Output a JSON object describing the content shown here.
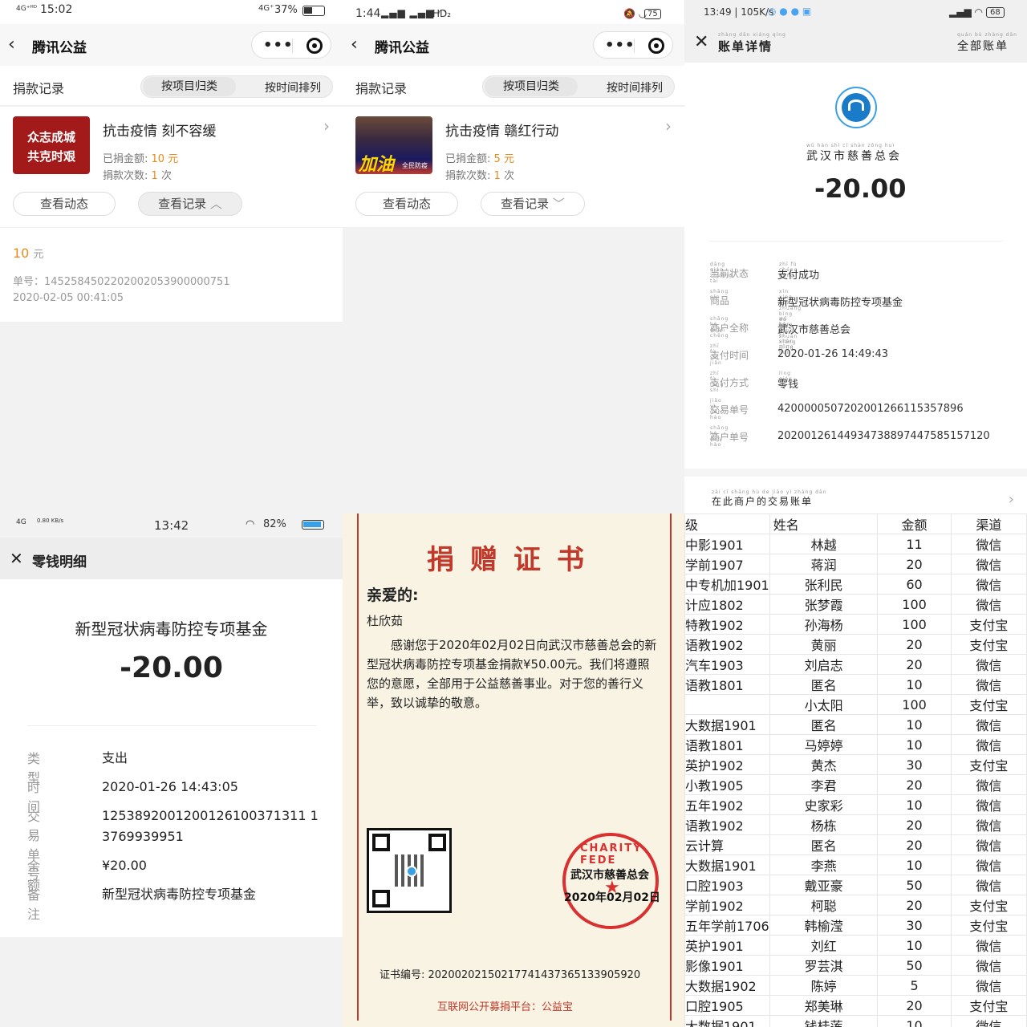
{
  "panel1": {
    "status": {
      "network": "4G⁺ᴴᴰ",
      "time": "15:02",
      "net2": "4G⁺",
      "battery": "37%"
    },
    "nav": {
      "title": "腾讯公益"
    },
    "records_label": "捐款记录",
    "seg": {
      "by_project": "按项目归类",
      "by_time": "按时间排列"
    },
    "thumb_text": [
      "众志成城",
      "共克时艰"
    ],
    "project": {
      "title": "抗击疫情 刻不容缓",
      "donated_label": "已捐金额:",
      "donated_value": "10",
      "donated_unit": "元",
      "count_label": "捐款次数:",
      "count_value": "1",
      "count_unit": "次"
    },
    "buttons": {
      "view_updates": "查看动态",
      "view_records": "查看记录"
    },
    "detail": {
      "amount": "10",
      "unit": "元",
      "order": "单号：14525845022020020539000007 51",
      "order_clean": "单号：1452584502202002053900000751",
      "date": "2020-02-05 00:41:05"
    }
  },
  "panel2": {
    "status": {
      "time": "1:44",
      "signal": "HD₂",
      "battery": "75"
    },
    "nav": {
      "title": "腾讯公益"
    },
    "records_label": "捐款记录",
    "seg": {
      "by_project": "按项目归类",
      "by_time": "按时间排列"
    },
    "thumb_text": "加油",
    "thumb_sub": "全民防疫",
    "project": {
      "title": "抗击疫情 赣红行动",
      "donated_label": "已捐金额:",
      "donated_value": "5",
      "donated_unit": "元",
      "count_label": "捐款次数:",
      "count_value": "1",
      "count_unit": "次"
    },
    "buttons": {
      "view_updates": "查看动态",
      "view_records": "查看记录"
    }
  },
  "panel3": {
    "status": {
      "time": "13:49 | 105K/s",
      "battery": "68"
    },
    "header": {
      "title": "账单详情",
      "title_pinyin": "zhàng dān xiáng qíng",
      "right": "全部账单",
      "right_pinyin": "quán bù zhàng dān"
    },
    "merchant_pinyin": "wǔ hàn shì cí shàn zǒng huì",
    "merchant": "武汉市慈善总会",
    "amount": "-20.00",
    "rows": [
      {
        "k": "当前状态",
        "kp": "dāng qián zhuàng tài",
        "v": "支付成功",
        "vp": "zhī fù chéng gōng"
      },
      {
        "k": "商品",
        "kp": "shāng pǐn",
        "v": "新型冠状病毒防控专项基金",
        "vp": "xīn xíng guàn zhuàng bìng dú fáng kòng zhuān xiàng jī jīn"
      },
      {
        "k": "商户全称",
        "kp": "shāng hù quán chēng",
        "v": "武汉市慈善总会",
        "vp": "wǔ hàn shì cí shàn zǒng huì"
      },
      {
        "k": "支付时间",
        "kp": "zhī fù shí jiān",
        "v": "2020-01-26 14:49:43",
        "vp": ""
      },
      {
        "k": "支付方式",
        "kp": "zhī fù fāng shì",
        "v": "零钱",
        "vp": "líng qián"
      },
      {
        "k": "交易单号",
        "kp": "jiāo yì dān hào",
        "v": "4200000507202001266115357896",
        "vp": ""
      },
      {
        "k": "商户单号",
        "kp": "shāng hù dān hào",
        "v": "20200126144934738897447585157120",
        "vp": ""
      }
    ],
    "footer": "在此商户的交易账单",
    "footer_pinyin": "zài cǐ shāng hù de jiāo yì zhàng dān"
  },
  "panel4": {
    "status": {
      "net": "4G",
      "speed": "0.80 KB/s",
      "time": "13:42",
      "battery": "82%"
    },
    "header": {
      "title": "零钱明细"
    },
    "fund": "新型冠状病毒防控专项基金",
    "amount": "-20.00",
    "rows": [
      {
        "k": "类型",
        "v": "支出"
      },
      {
        "k": "时间",
        "v": "2020-01-26 14:43:05"
      },
      {
        "k": "交易单号",
        "v": "1253892001200126100371311 13769939951"
      },
      {
        "k": "余额",
        "v": "¥20.00"
      },
      {
        "k": "备注",
        "v": "新型冠状病毒防控专项基金"
      }
    ]
  },
  "panel5": {
    "title": "捐赠证书",
    "salutation": "亲爱的:",
    "name": "杜欣茹",
    "body": "感谢您于2020年02月02日向武汉市慈善总会的新型冠状病毒防控专项基金捐款¥50.00元。我们将遵照您的意愿，全部用于公益慈善事业。对于您的善行义举，致以诚挚的敬意。",
    "seal_org": "武汉市慈善总会",
    "seal_date": "2020年02月02日",
    "seal_ring": "CHARITY FEDE",
    "cert_no": "证书编号: 20200202150217741437365133905920",
    "platform": "互联网公开募捐平台：公益宝"
  },
  "panel6": {
    "headers": [
      "级",
      "姓名",
      "金额",
      "渠道"
    ],
    "rows": [
      [
        "中影1901",
        "林越",
        "11",
        "微信"
      ],
      [
        "学前1907",
        "蒋润",
        "20",
        "微信"
      ],
      [
        "中专机加1901",
        "张利民",
        "60",
        "微信"
      ],
      [
        "计应1802",
        "张梦霞",
        "100",
        "微信"
      ],
      [
        "特教1902",
        "孙海杨",
        "100",
        "支付宝"
      ],
      [
        "语教1902",
        "黄丽",
        "20",
        "支付宝"
      ],
      [
        "汽车1903",
        "刘启志",
        "20",
        "微信"
      ],
      [
        "语教1801",
        "匿名",
        "10",
        "微信"
      ],
      [
        "",
        "小太阳",
        "100",
        "支付宝"
      ],
      [
        "大数据1901",
        "匿名",
        "10",
        "微信"
      ],
      [
        "语教1801",
        "马婷婷",
        "10",
        "微信"
      ],
      [
        "英护1902",
        "黄杰",
        "30",
        "支付宝"
      ],
      [
        "小教1905",
        "李君",
        "20",
        "微信"
      ],
      [
        "五年1902",
        "史家彩",
        "10",
        "微信"
      ],
      [
        "语教1902",
        "杨栋",
        "20",
        "微信"
      ],
      [
        "云计算",
        "匿名",
        "20",
        "微信"
      ],
      [
        "大数据1901",
        "李燕",
        "10",
        "微信"
      ],
      [
        "口腔1903",
        "戴亚豪",
        "50",
        "微信"
      ],
      [
        "学前1902",
        "柯聪",
        "20",
        "支付宝"
      ],
      [
        "五年学前1706",
        "韩榆滢",
        "30",
        "支付宝"
      ],
      [
        "英护1901",
        "刘红",
        "10",
        "微信"
      ],
      [
        "影像1901",
        "罗芸淇",
        "50",
        "微信"
      ],
      [
        "大数据1902",
        "陈婷",
        "5",
        "微信"
      ],
      [
        "口腔1905",
        "郑美琳",
        "20",
        "支付宝"
      ],
      [
        "大数据1901",
        "钱桂莲",
        "10",
        "微信"
      ]
    ]
  },
  "colors": {
    "accent_orange": "#e88a1a",
    "cert_red": "#c0392b",
    "thumb_red": "#a31a1a"
  }
}
